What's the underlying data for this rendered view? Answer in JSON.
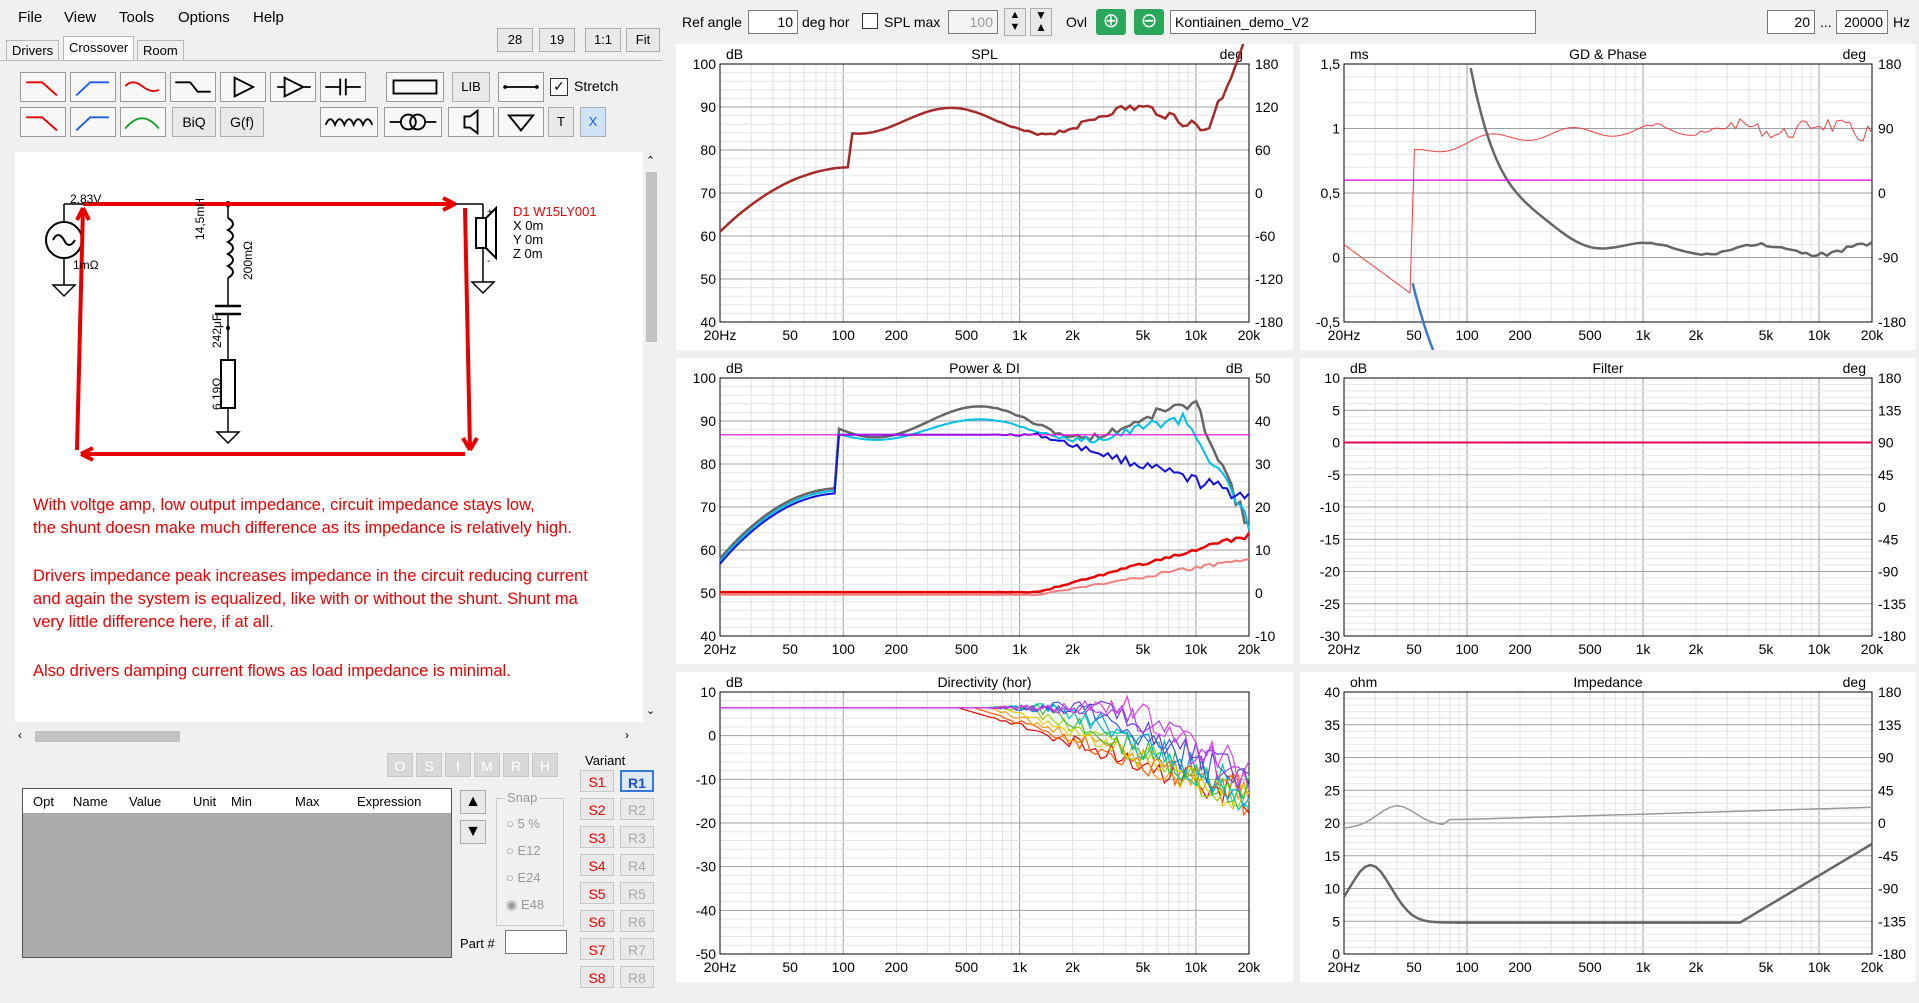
{
  "menu": [
    "File",
    "View",
    "Tools",
    "Options",
    "Help"
  ],
  "tabs": [
    {
      "label": "Drivers"
    },
    {
      "label": "Crossover"
    },
    {
      "label": "Room"
    }
  ],
  "top_right_buttons": [
    "28",
    "19",
    "1:1",
    "Fit"
  ],
  "toolbar": {
    "lib_label": "LIB",
    "biq_label": "BiQ",
    "gf_label": "G(f)",
    "t_label": "T",
    "x_label": "X",
    "stretch_label": "Stretch",
    "stretch_checked": true
  },
  "schematic": {
    "source_voltage": "2,83V",
    "source_impedance": "1mΩ",
    "inductor_value": "14,5mH",
    "inductor_resistance": "200mΩ",
    "capacitor_value": "242μF",
    "resistor_value": "6,19Ω",
    "driver_name": "D1 W15LY001",
    "driver_x": "X 0m",
    "driver_y": "Y 0m",
    "driver_z": "Z 0m",
    "notes": [
      "With voltge amp, low output impedance, circuit impedance stays low,",
      "the shunt doesn make much difference as its impedance is relatively high.",
      "Drivers impedance peak increases impedance in the circuit reducing current",
      "and again the system is equalized, like with or without the shunt. Shunt ma",
      "very little difference here, if at all.",
      "Also drivers damping current flows as load impedance is minimal."
    ]
  },
  "param_table": {
    "columns": [
      "Opt",
      "Name",
      "Value",
      "Unit",
      "Min",
      "Max",
      "Expression"
    ]
  },
  "snap": {
    "label": "Snap",
    "options": [
      "5 %",
      "E12",
      "E24",
      "E48"
    ],
    "selected": "E48"
  },
  "part_label": "Part #",
  "small_flags": [
    "O",
    "S",
    "I",
    "M",
    "R",
    "H"
  ],
  "variant": {
    "label": "Variant",
    "s": [
      "S1",
      "S2",
      "S3",
      "S4",
      "S5",
      "S6",
      "S7",
      "S8"
    ],
    "r": [
      "R1",
      "R2",
      "R3",
      "R4",
      "R5",
      "R6",
      "R7",
      "R8"
    ],
    "active": "R1"
  },
  "topbar": {
    "ref_angle_label": "Ref angle",
    "ref_angle_value": "10",
    "deg_hor_label": "deg hor",
    "spl_max_label": "SPL max",
    "spl_max_value": "100",
    "ovl_label": "Ovl",
    "project_name": "Kontiainen_demo_V2",
    "freq_min": "20",
    "freq_sep": "...",
    "freq_max": "20000",
    "hz_label": "Hz"
  },
  "colors": {
    "accent_red": "#e60000",
    "ovl_green": "#2aa75a",
    "magenta": "#ff00ff"
  },
  "charts": [
    {
      "id": "spl",
      "title": "SPL",
      "left_unit": "dB",
      "right_unit": "deg",
      "left_ticks": [
        "100",
        "90",
        "80",
        "70",
        "60",
        "50",
        "40"
      ],
      "right_ticks": [
        "180",
        "120",
        "60",
        "0",
        "-60",
        "-120",
        "-180"
      ],
      "x_ticks": [
        "20Hz",
        "50",
        "100",
        "200",
        "500",
        "1k",
        "2k",
        "5k",
        "10k",
        "20k"
      ]
    },
    {
      "id": "gd",
      "title": "GD & Phase",
      "left_unit": "ms",
      "right_unit": "deg",
      "left_ticks": [
        "1,5",
        "1",
        "0,5",
        "0",
        "-0,5"
      ],
      "right_ticks": [
        "180",
        "90",
        "0",
        "-90",
        "-180"
      ],
      "x_ticks": [
        "20Hz",
        "50",
        "100",
        "200",
        "500",
        "1k",
        "2k",
        "5k",
        "10k",
        "20k"
      ]
    },
    {
      "id": "power",
      "title": "Power & DI",
      "left_unit": "dB",
      "right_unit": "dB",
      "left_ticks": [
        "100",
        "90",
        "80",
        "70",
        "60",
        "50",
        "40"
      ],
      "right_ticks": [
        "50",
        "40",
        "30",
        "20",
        "10",
        "0",
        "-10"
      ],
      "x_ticks": [
        "20Hz",
        "50",
        "100",
        "200",
        "500",
        "1k",
        "2k",
        "5k",
        "10k",
        "20k"
      ]
    },
    {
      "id": "filter",
      "title": "Filter",
      "left_unit": "dB",
      "right_unit": "deg",
      "left_ticks": [
        "10",
        "5",
        "0",
        "-5",
        "-10",
        "-15",
        "-20",
        "-25",
        "-30"
      ],
      "right_ticks": [
        "180",
        "135",
        "90",
        "45",
        "0",
        "-45",
        "-90",
        "-135",
        "-180"
      ],
      "x_ticks": [
        "20Hz",
        "50",
        "100",
        "200",
        "500",
        "1k",
        "2k",
        "5k",
        "10k",
        "20k"
      ]
    },
    {
      "id": "directivity",
      "title": "Directivity (hor)",
      "left_unit": "dB",
      "right_unit": "",
      "left_ticks": [
        "10",
        "0",
        "-10",
        "-20",
        "-30",
        "-40",
        "-50"
      ],
      "right_ticks": [],
      "x_ticks": [
        "20Hz",
        "50",
        "100",
        "200",
        "500",
        "1k",
        "2k",
        "5k",
        "10k",
        "20k"
      ]
    },
    {
      "id": "impedance",
      "title": "Impedance",
      "left_unit": "ohm",
      "right_unit": "deg",
      "left_ticks": [
        "40",
        "35",
        "30",
        "25",
        "20",
        "15",
        "10",
        "5",
        "0"
      ],
      "right_ticks": [
        "180",
        "135",
        "90",
        "45",
        "0",
        "-45",
        "-90",
        "-135",
        "-180"
      ],
      "x_ticks": [
        "20Hz",
        "50",
        "100",
        "200",
        "500",
        "1k",
        "2k",
        "5k",
        "10k",
        "20k"
      ]
    }
  ]
}
